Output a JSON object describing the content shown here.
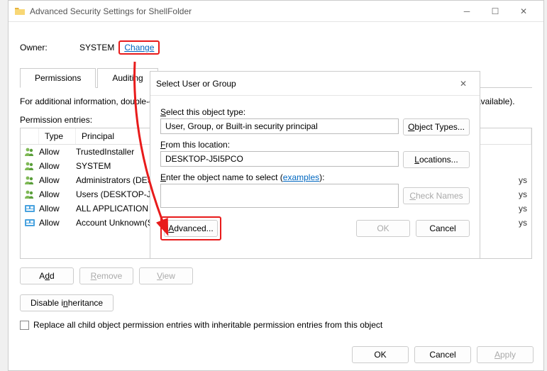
{
  "mainWindow": {
    "title": "Advanced Security Settings for ShellFolder",
    "ownerLabel": "Owner:",
    "ownerValue": "SYSTEM",
    "changeLink": "Change",
    "tabs": {
      "permissions": "Permissions",
      "auditing": "Auditing"
    },
    "infoText": "For additional information, double-click a permission entry. To modify a permission entry, select the entry and click Edit (if available).",
    "entriesLabel": "Permission entries:",
    "gridHeaders": {
      "type": "Type",
      "principal": "Principal"
    },
    "entries": [
      {
        "iconType": "users",
        "type": "Allow",
        "principal": "TrustedInstaller",
        "suffix": ""
      },
      {
        "iconType": "users",
        "type": "Allow",
        "principal": "SYSTEM",
        "suffix": ""
      },
      {
        "iconType": "users",
        "type": "Allow",
        "principal": "Administrators (DESKTOP-J5I5PCO\\Administrators)",
        "suffix": "ys"
      },
      {
        "iconType": "users",
        "type": "Allow",
        "principal": "Users (DESKTOP-J5I5PCO\\Users)",
        "suffix": "ys"
      },
      {
        "iconType": "pkg",
        "type": "Allow",
        "principal": "ALL APPLICATION PACKAGES",
        "suffix": "ys"
      },
      {
        "iconType": "pkg",
        "type": "Allow",
        "principal": "Account Unknown(S-1-15-3-1024-...)",
        "suffix": "ys"
      }
    ],
    "buttons": {
      "add": "Add",
      "remove": "Remove",
      "view": "View",
      "disableInheritance": "Disable inheritance",
      "replaceAll": "Replace all child object permission entries with inheritable permission entries from this object",
      "ok": "OK",
      "cancel": "Cancel",
      "apply": "Apply"
    }
  },
  "modal": {
    "title": "Select User or Group",
    "objectTypeLabel": "Select this object type:",
    "objectTypeValue": "User, Group, or Built-in security principal",
    "objectTypesBtn": "Object Types...",
    "locationLabel": "From this location:",
    "locationValue": "DESKTOP-J5I5PCO",
    "locationsBtn": "Locations...",
    "enterNameLabel": "Enter the object name to select (",
    "examplesLink": "examples",
    "enterNameLabelEnd": "):",
    "checkNamesBtn": "Check Names",
    "advancedBtn": "Advanced...",
    "okBtn": "OK",
    "cancelBtn": "Cancel"
  }
}
